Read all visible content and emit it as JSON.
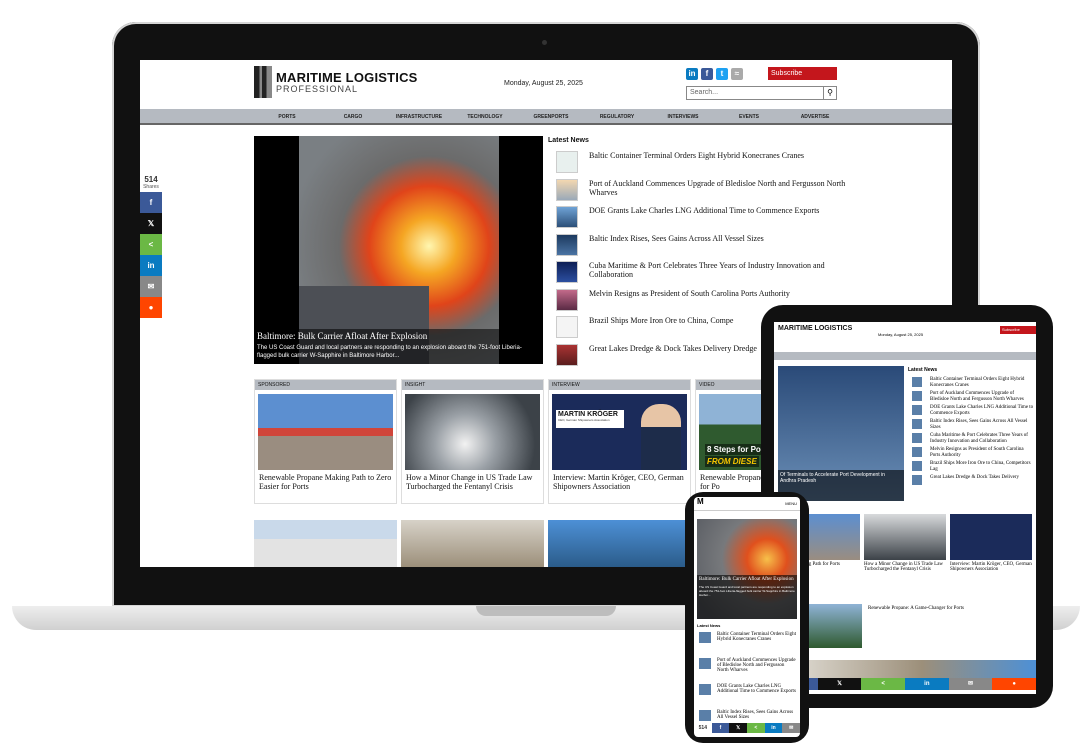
{
  "site": {
    "logo_main": "MARITIME LOGISTICS",
    "logo_sub": "PROFESSIONAL",
    "date": "Monday, August 25, 2025",
    "subscribe": "Subscribe",
    "search_placeholder": "Search..."
  },
  "nav": [
    "PORTS",
    "CARGO",
    "INFRASTRUCTURE",
    "TECHNOLOGY",
    "GREENPORTS",
    "REGULATORY",
    "INTERVIEWS",
    "EVENTS",
    "ADVERTISE"
  ],
  "share": {
    "count": "514",
    "label": "Shares"
  },
  "hero": {
    "title": "Baltimore: Bulk Carrier Afloat After Explosion",
    "desc": "The US Coast Guard and local partners are responding to an explosion aboard the 751-foot Liberia-flagged bulk carrier W-Sapphire in Baltimore Harbor..."
  },
  "latest": {
    "heading": "Latest News",
    "items": [
      "Baltic Container Terminal Orders Eight Hybrid Konecranes Cranes",
      "Port of Auckland Commences Upgrade of Bledisloe North and Fergusson North Wharves",
      "DOE Grants Lake Charles LNG Additional Time to Commence Exports",
      "Baltic Index Rises, Sees Gains Across All Vessel Sizes",
      "Cuba Maritime & Port Celebrates Three Years of Industry Innovation and Collaboration",
      "Melvin Resigns as President of South Carolina Ports Authority",
      "Brazil Ships More Iron Ore to China, Compe",
      "Great Lakes Dredge & Dock Takes Delivery Dredge"
    ]
  },
  "sections": [
    {
      "label": "SPONSORED",
      "title": "Renewable Propane Making Path to Zero Easier for Ports"
    },
    {
      "label": "INSIGHT",
      "title": "How a Minor Change in US Trade Law Turbocharged the Fentanyl Crisis"
    },
    {
      "label": "INTERVIEW",
      "title": "Interview: Martin Kröger, CEO, German Shipowners Association",
      "banner": "MARTIN KRÖGER",
      "banner_sub": "CEO, German Shipowners Association"
    },
    {
      "label": "VIDEO",
      "title": "Renewable Propane: A Game-Changer for Po",
      "banner": "8 Steps for Po",
      "banner_sub": "FROM DIESE"
    }
  ],
  "tablet": {
    "logo": "MARITIME LOGISTICS",
    "date": "Monday, August 25, 2025",
    "subscribe": "Subscribe",
    "hero_caption": "Of Terminals to Accelerate Port Development in Andhra Pradesh",
    "latest_heading": "Latest News",
    "news": [
      "Baltic Container Terminal Orders Eight Hybrid Konecranes Cranes",
      "Port of Auckland Commences Upgrade of Bledisloe North and Fergusson North Wharves",
      "DOE Grants Lake Charles LNG Additional Time to Commence Exports",
      "Baltic Index Rises, Sees Gains Across All Vessel Sizes",
      "Cuba Maritime & Port Celebrates Three Years of Industry Innovation and Collaboration",
      "Melvin Resigns as President of South Carolina Ports Authority",
      "Brazil Ships More Iron Ore to China, Competitors Lag",
      "Great Lakes Dredge & Dock Takes Delivery"
    ],
    "sections": [
      "Propane Making Path for Ports",
      "How a Minor Change in US Trade Law Turbocharged the Fentanyl Crisis",
      "Interview: Martin Kröger, CEO, German Shipowners Association"
    ],
    "video_title": "Renewable Propane: A Game-Changer for Ports"
  },
  "phone": {
    "menu": "MENU",
    "hero_title": "Baltimore: Bulk Carrier Afloat After Explosion",
    "hero_desc": "The US Coast Guard and local partners are responding to an explosion aboard the 751-foot Liberia-flagged bulk carrier W-Sapphire in Baltimore Harbor...",
    "latest_heading": "Latest News",
    "news": [
      "Baltic Container Terminal Orders Eight Hybrid Konecranes Cranes",
      "Port of Auckland Commences Upgrade of Bledisloe North and Fergusson North Wharves",
      "DOE Grants Lake Charles LNG Additional Time to Commence Exports",
      "Baltic Index Rises, Sees Gains Across All Vessel Sizes"
    ],
    "share_count": "514"
  },
  "colors": {
    "accent_red": "#c4161c",
    "nav_gray": "#b5bac1",
    "facebook": "#3b5998",
    "x": "#111111",
    "share": "#6bb845",
    "linkedin": "#0a7bc1",
    "email": "#888888",
    "reddit": "#ff4500"
  },
  "icons": [
    "linkedin-icon",
    "facebook-icon",
    "twitter-icon",
    "rss-icon",
    "search-icon",
    "share-icon",
    "email-icon",
    "reddit-icon"
  ]
}
